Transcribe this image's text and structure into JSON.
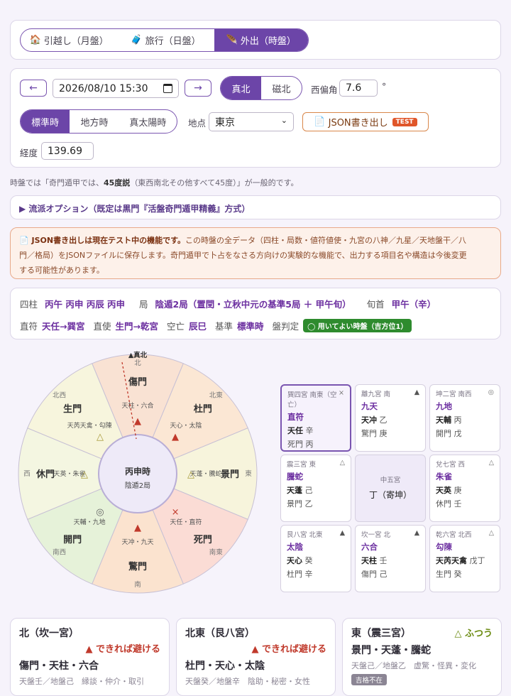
{
  "tabs": [
    {
      "icon": "🏠",
      "label": "引越し（月盤）"
    },
    {
      "icon": "🧳",
      "label": "旅行（日盤）"
    },
    {
      "icon": "🪶",
      "label": "外出（時盤）"
    }
  ],
  "controls": {
    "prev": "←",
    "next": "→",
    "datetime": "2026/08/10  15:30",
    "north_true": "真北",
    "north_mag": "磁北",
    "declination_label": "西偏角",
    "declination_value": "7.6",
    "declination_unit": "°",
    "time_std": "標準時",
    "time_local": "地方時",
    "time_solar": "真太陽時",
    "place_label": "地点",
    "place_value": "東京",
    "json_label": "JSON書き出し",
    "json_badge": "TEST",
    "longitude_label": "経度",
    "longitude_value": "139.69"
  },
  "note": {
    "pre": "時盤では「奇門遁甲では、",
    "bold": "45度説",
    "post": "（東西南北その他すべて45度）」が一般的です。"
  },
  "school": "▶ 流派オプション（既定は黒門『活盤奇門遁甲精義』方式）",
  "warning": {
    "bold": "📄 JSON書き出しは現在テスト中の機能です。",
    "line1": "この時盤の全データ（四柱・局数・値符値使・九宮の八神／九星／天地盤干／八",
    "line2": "門／格局）をJSONファイルに保存します。奇門遁甲で卜占をなさる方向けの実験的な機能で、出力する項目名や構造は今後変更",
    "line3": "する可能性があります。"
  },
  "summary": {
    "pillars_label": "四柱",
    "pillars": "丙午 丙申 丙辰 丙申",
    "ju_label": "局",
    "ju": "陰遁2局（置閏・立秋中元の基準5局 ＋ 甲午旬）",
    "xunshou_label": "旬首",
    "xunshou": "甲午（辛）",
    "zhifu_label": "直符",
    "zhifu": "天任→巽宮",
    "zhishi_label": "直使",
    "zhishi": "生門→乾宮",
    "kongwang_label": "空亡",
    "kongwang": "辰巳",
    "kijun_label": "基準",
    "kijun": "標準時",
    "hantei_label": "盤判定",
    "hantei": "◯ 用いてよい時盤（吉方位1）"
  },
  "wheel": {
    "north_marker": "▲真北",
    "center_title": "丙申時",
    "center_sub": "陰遁2局",
    "directions": {
      "n": "北",
      "ne": "北東",
      "e": "東",
      "se": "南東",
      "s": "南",
      "sw": "南西",
      "w": "西",
      "nw": "北西"
    },
    "sectors": [
      {
        "gate": "傷門",
        "sub": "天柱・六合",
        "mark": "▲"
      },
      {
        "gate": "杜門",
        "sub": "天心・太陰",
        "mark": "▲"
      },
      {
        "gate": "景門",
        "sub": "天蓬・騰蛇",
        "mark": "△"
      },
      {
        "gate": "死門",
        "sub": "天任・直符",
        "mark": "×"
      },
      {
        "gate": "驚門",
        "sub": "天冲・九天",
        "mark": "▲"
      },
      {
        "gate": "開門",
        "sub": "天輔・九地",
        "mark": "◎"
      },
      {
        "gate": "休門",
        "sub": "天英・朱雀",
        "mark": "△"
      },
      {
        "gate": "生門",
        "sub": "天芮天禽・勾陳",
        "mark": "△"
      }
    ]
  },
  "palaces": [
    {
      "h": "巽四宮 南東（空亡）",
      "m": "×",
      "god": "直符",
      "s": "天任",
      "sg": "辛",
      "d": "死門",
      "dg": "丙"
    },
    {
      "h": "離九宮 南",
      "m": "▲",
      "god": "九天",
      "s": "天冲",
      "sg": "乙",
      "d": "驚門",
      "dg": "庚"
    },
    {
      "h": "坤二宮 南西",
      "m": "◎",
      "god": "九地",
      "s": "天輔",
      "sg": "丙",
      "d": "開門",
      "dg": "戊"
    },
    {
      "h": "震三宮 東",
      "m": "△",
      "god": "騰蛇",
      "s": "天蓬",
      "sg": "己",
      "d": "景門",
      "dg": "乙"
    },
    {
      "h": "中五宮",
      "center": "丁（寄坤）"
    },
    {
      "h": "兌七宮 西",
      "m": "△",
      "god": "朱雀",
      "s": "天英",
      "sg": "庚",
      "d": "休門",
      "dg": "壬"
    },
    {
      "h": "艮八宮 北東",
      "m": "▲",
      "god": "太陰",
      "s": "天心",
      "sg": "癸",
      "d": "杜門",
      "dg": "辛"
    },
    {
      "h": "坎一宮 北",
      "m": "▲",
      "god": "六合",
      "s": "天柱",
      "sg": "壬",
      "d": "傷門",
      "dg": "己"
    },
    {
      "h": "乾六宮 北西",
      "m": "△",
      "god": "勾陳",
      "s": "天芮天禽",
      "sg": "戊丁",
      "d": "生門",
      "dg": "癸"
    }
  ],
  "directions_cards": [
    {
      "title": "北（坎一宮）",
      "verdict": "▲ できれば避ける",
      "main": "傷門・天柱・六合",
      "sub": "天盤壬／地盤己　縁談・仲介・取引"
    },
    {
      "title": "北東（艮八宮）",
      "verdict": "▲ できれば避ける",
      "main": "杜門・天心・太陰",
      "sub": "天盤癸／地盤辛　陰助・秘密・女性"
    },
    {
      "title": "東（震三宮）",
      "verdict": "△ ふつう",
      "main": "景門・天蓬・騰蛇",
      "sub": "天盤己／地盤乙　虚驚・怪異・変化",
      "badge": "吉格不在"
    }
  ],
  "colors": {
    "accent": "#6c45a8",
    "danger": "#c0392b",
    "good": "#2e8b2e"
  }
}
